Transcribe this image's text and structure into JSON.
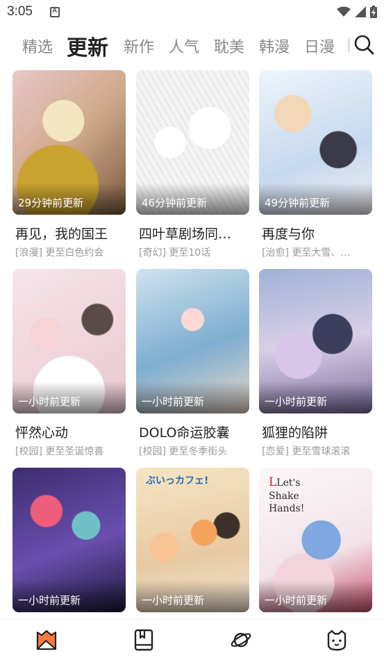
{
  "status_bar": {
    "time": "3:05",
    "icons": [
      "app-notification-icon",
      "wifi-icon",
      "cell-signal-icon",
      "battery-charging-icon"
    ]
  },
  "tabs": [
    {
      "label": "精选",
      "active": false
    },
    {
      "label": "更新",
      "active": true
    },
    {
      "label": "新作",
      "active": false
    },
    {
      "label": "人气",
      "active": false
    },
    {
      "label": "耽美",
      "active": false
    },
    {
      "label": "韩漫",
      "active": false
    },
    {
      "label": "日漫",
      "active": false
    }
  ],
  "search_icon": "search-icon",
  "comics": [
    {
      "title": "再见，我的国王",
      "subtitle": "[浪漫] 更至白色约会",
      "updated": "29分钟前更新"
    },
    {
      "title": "四叶草剧场同…",
      "subtitle": "[奇幻] 更至10话",
      "updated": "46分钟前更新"
    },
    {
      "title": "再度与你",
      "subtitle": "[治愈] 更至大雪、…",
      "updated": "49分钟前更新"
    },
    {
      "title": "怦然心动",
      "subtitle": "[校园] 更至圣诞惊喜",
      "updated": "一小时前更新"
    },
    {
      "title": "DOLO命运胶囊",
      "subtitle": "[校园] 更至冬季街头",
      "updated": "一小时前更新"
    },
    {
      "title": "狐狸的陷阱",
      "subtitle": "[恋爱] 更至雪球滚滚",
      "updated": "一小时前更新"
    },
    {
      "title": "",
      "subtitle": "",
      "updated": "一小时前更新"
    },
    {
      "title": "",
      "subtitle": "",
      "updated": "一小时前更新",
      "cover_text": "ぶいっカフェ!"
    },
    {
      "title": "",
      "subtitle": "",
      "updated": "一小时前更新",
      "cover_text": [
        "Let's",
        "Shake",
        "Hands!"
      ]
    }
  ],
  "bottom_nav": [
    {
      "icon": "comic-home-icon",
      "active": true
    },
    {
      "icon": "bookshelf-icon",
      "active": false
    },
    {
      "icon": "planet-icon",
      "active": false
    },
    {
      "icon": "cat-profile-icon",
      "active": false
    }
  ],
  "colors": {
    "accent": "#ff7a3d",
    "text": "#222222",
    "muted": "#999999"
  }
}
